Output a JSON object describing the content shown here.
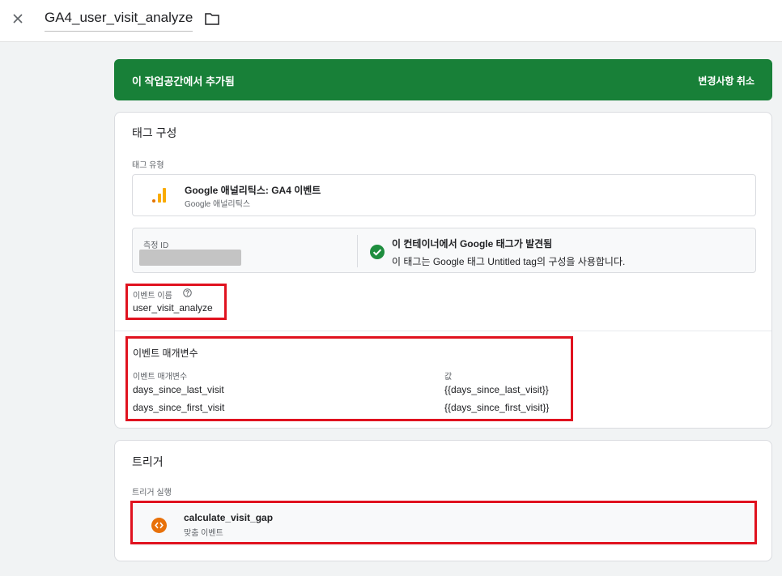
{
  "header": {
    "title": "GA4_user_visit_analyze",
    "close_icon": "close-icon",
    "folder_icon": "folder-icon"
  },
  "banner": {
    "message": "이 작업공간에서 추가됨",
    "action": "변경사항 취소",
    "color": "#188038"
  },
  "tag_config": {
    "section_title": "태그 구성",
    "tag_type_label": "태그 유형",
    "tag_type": {
      "name": "Google 애널리틱스: GA4 이벤트",
      "sub": "Google 애널리틱스",
      "icon": "analytics-icon"
    },
    "measurement": {
      "label": "측정 ID",
      "found_title": "이 컨테이너에서 Google 태그가 발견됨",
      "found_sub": "이 태그는 Google 태그 Untitled tag의 구성을 사용합니다.",
      "check_icon": "check-circle-icon"
    },
    "event_name": {
      "label": "이벤트 이름",
      "help_icon": "help-icon",
      "value": "user_visit_analyze"
    },
    "event_params": {
      "section_title": "이벤트 매개변수",
      "col_param": "이벤트 매개변수",
      "col_value": "값",
      "rows": [
        {
          "param": "days_since_last_visit",
          "value": "{{days_since_last_visit}}"
        },
        {
          "param": "days_since_first_visit",
          "value": "{{days_since_first_visit}}"
        }
      ]
    }
  },
  "trigger": {
    "section_title": "트리거",
    "fire_label": "트리거 실행",
    "item": {
      "name": "calculate_visit_gap",
      "sub": "맞춤 이벤트",
      "icon": "custom-event-icon"
    }
  },
  "colors": {
    "highlight": "#e0121f",
    "accent_orange": "#e8710a",
    "analytics_orange": "#f9ab00",
    "check_green": "#1e8e3e"
  }
}
